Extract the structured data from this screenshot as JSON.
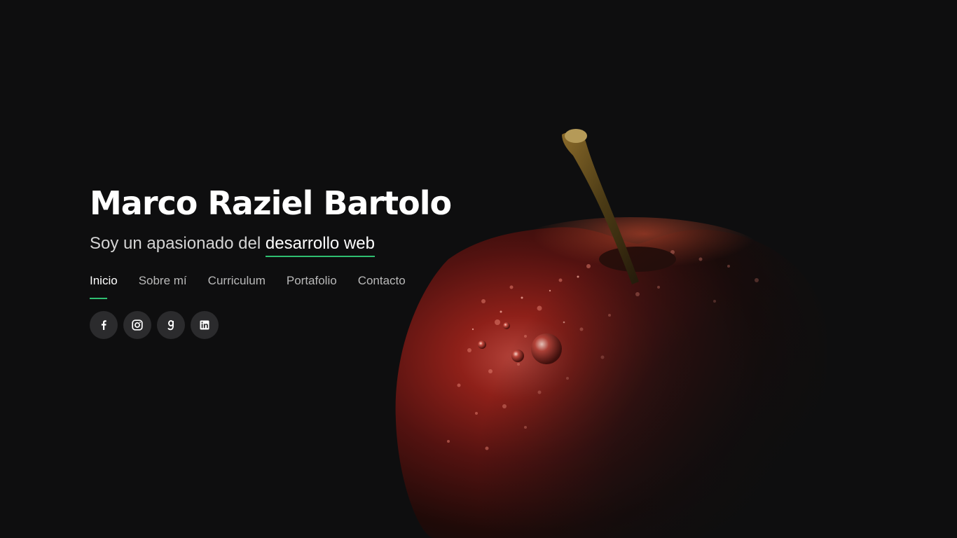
{
  "hero": {
    "title": "Marco Raziel Bartolo",
    "subtitle_prefix": "Soy un apasionado del",
    "subtitle_highlight": "desarrollo web"
  },
  "nav": {
    "items": [
      {
        "label": "Inicio",
        "active": true
      },
      {
        "label": "Sobre mí",
        "active": false
      },
      {
        "label": "Curriculum",
        "active": false
      },
      {
        "label": "Portafolio",
        "active": false
      },
      {
        "label": "Contacto",
        "active": false
      }
    ]
  },
  "social": {
    "icons": [
      "facebook-icon",
      "instagram-icon",
      "goodreads-icon",
      "linkedin-icon"
    ]
  },
  "colors": {
    "background": "#0e0e0f",
    "accent": "#2fbf71",
    "social_bg": "#2b2b2d",
    "apple_red": "#8c1a14"
  }
}
